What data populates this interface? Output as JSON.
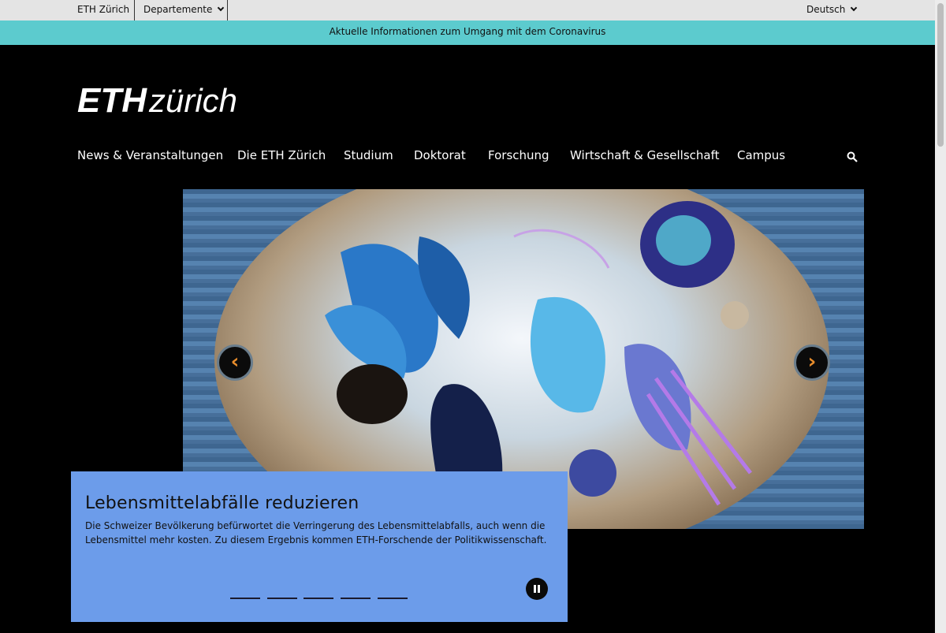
{
  "topbar": {
    "eth_link": "ETH Zürich",
    "departments": "Departemente",
    "language": "Deutsch"
  },
  "infobar": {
    "text": "Aktuelle Informationen zum Umgang mit dem Coronavirus"
  },
  "logo": {
    "text_bold": "ETH",
    "text_light": "zürich"
  },
  "nav": {
    "items": [
      "News & Veranstaltungen",
      "Die ETH Zürich",
      "Studium",
      "Doktorat",
      "Forschung",
      "Wirtschaft & Gesellschaft",
      "Campus"
    ]
  },
  "hero": {
    "prev_label": "‹",
    "next_label": "›",
    "title": "Lebensmittelabfälle reduzieren",
    "text": "Die Schweizer Bevölkerung befürwortet die Verringerung des Lebensmittelabfalls, auch wenn die Lebensmittel mehr kosten. Zu diesem Ergebnis kommen ETH-Forschende der Politikwissenschaft.",
    "slide_count": 5,
    "active_slide": 1
  },
  "colors": {
    "infobar": "#5ccbce",
    "caption": "#6c9cea",
    "arrow": "#e88d2c"
  },
  "icons": [
    "chevron-down-icon",
    "search-icon",
    "pause-icon"
  ]
}
